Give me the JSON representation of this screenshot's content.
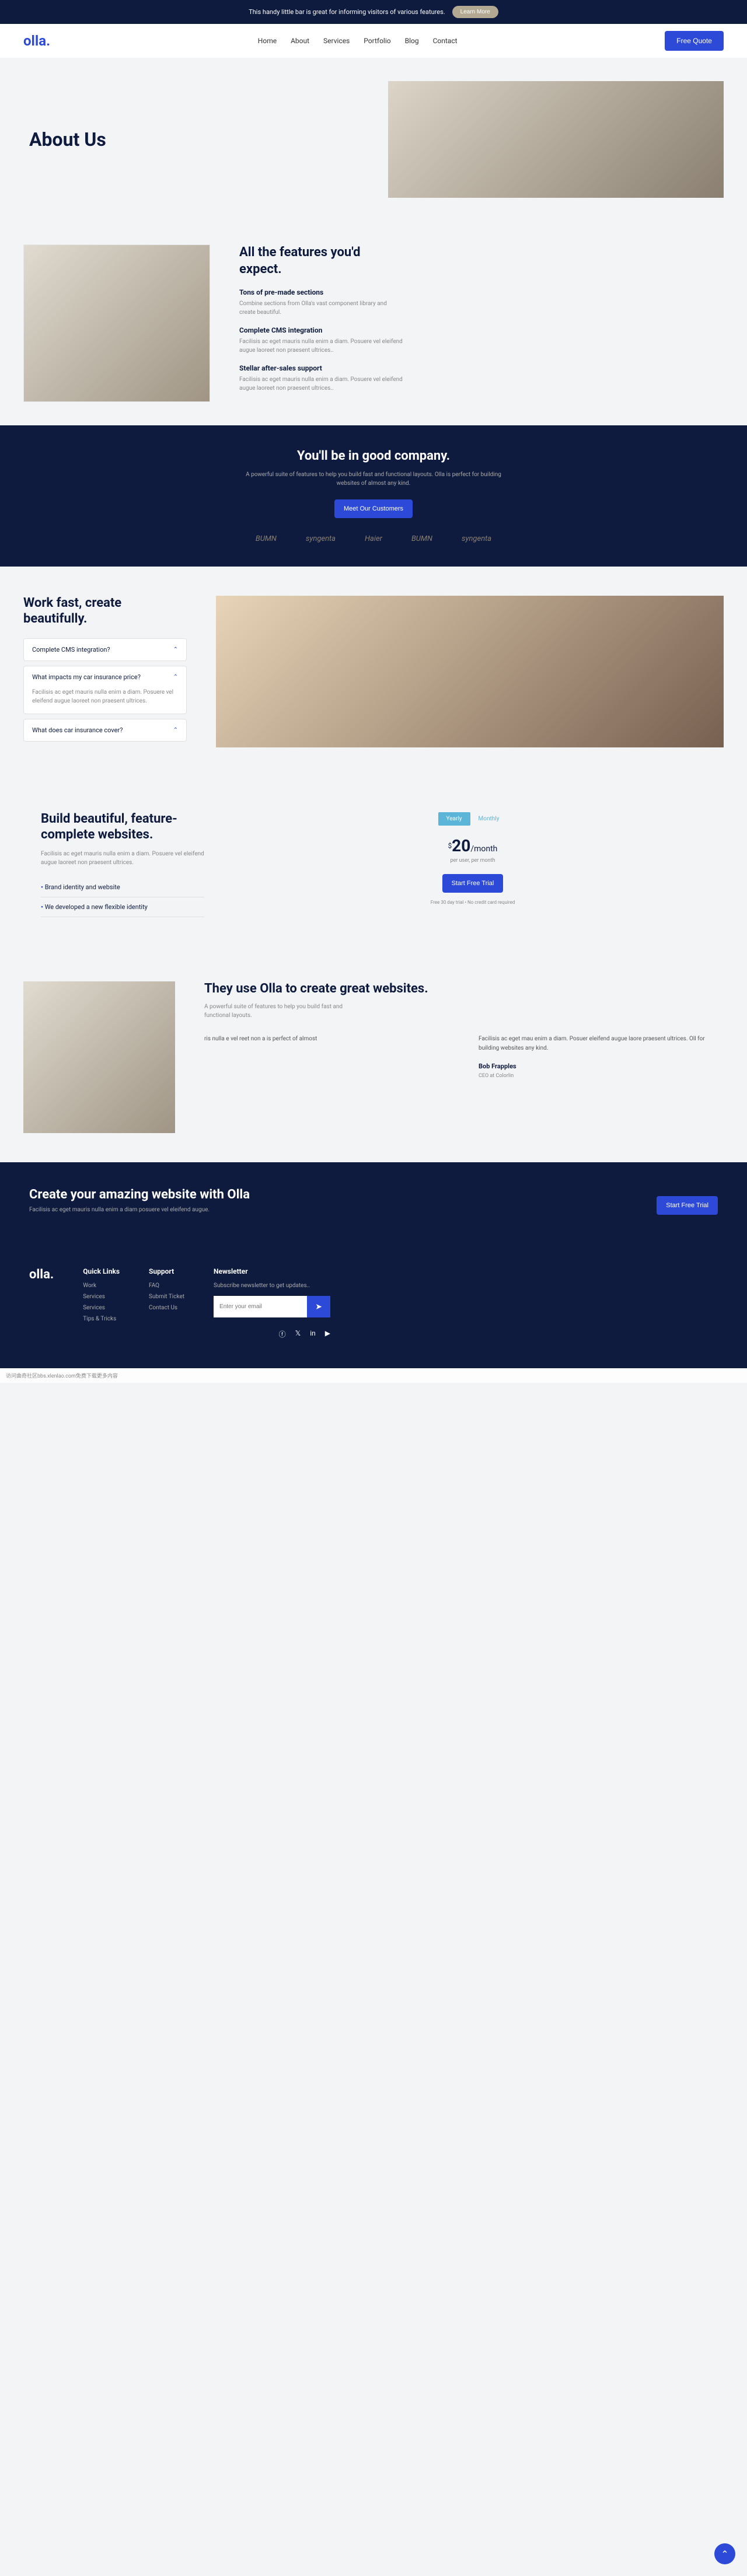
{
  "topbar": {
    "text": "This handy little bar is great for informing visitors of various features.",
    "button": "Learn More"
  },
  "brand": "olla.",
  "nav": [
    "Home",
    "About",
    "Services",
    "Portfolio",
    "Blog",
    "Contact"
  ],
  "quote": "Free Quote",
  "hero": {
    "title": "About Us"
  },
  "features": {
    "title": "All the features you'd expect.",
    "items": [
      {
        "h": "Tons of pre-made sections",
        "p": "Combine sections from Olla's vast component library and create beautiful."
      },
      {
        "h": "Complete CMS integration",
        "p": "Facilisis ac eget mauris nulla enim a diam. Posuere vel eleifend augue laoreet non praesent ultrices.."
      },
      {
        "h": "Stellar after-sales support",
        "p": "Facilisis ac eget mauris nulla enim a diam. Posuere vel eleifend augue laoreet non praesent ultrices.."
      }
    ]
  },
  "company": {
    "title": "You'll be in good company.",
    "text": "A powerful suite of features to help you build fast and functional layouts. Olla is perfect for building websites of almost any kind.",
    "button": "Meet Our Customers",
    "logos": [
      "BUMN",
      "syngenta",
      "Haier",
      "BUMN",
      "syngenta"
    ]
  },
  "accordion": {
    "title": "Work fast, create beautifully.",
    "items": [
      {
        "q": "Complete CMS integration?",
        "open": false
      },
      {
        "q": "What impacts my car insurance price?",
        "open": true,
        "a": "Facilisis ac eget mauris nulla enim a diam. Posuere vel eleifend augue laoreet non praesent ultrices."
      },
      {
        "q": "What does car insurance cover?",
        "open": false
      }
    ]
  },
  "pricing": {
    "title": "Build beautiful, feature-complete websites.",
    "text": "Facilisis ac eget mauris nulla enim a diam. Posuere vel eleifend augue laoreet non praesent ultrices.",
    "bullets": [
      "Brand identity and website",
      "We developed a new flexible identity"
    ],
    "tabs": {
      "active": "Yearly",
      "inactive": "Monthly"
    },
    "currency": "$",
    "amount": "20",
    "period": "/month",
    "sub": "per user, per month",
    "button": "Start Free Trial",
    "note": "Free 30 day trial • No credit card required"
  },
  "testimonial": {
    "title": "They use Olla to create great websites.",
    "text": "A powerful suite of features to help you build fast and functional layouts.",
    "col1": "ris nulla e vel reet non a is perfect of almost",
    "col2": "Facilisis ac eget mau enim a diam. Posuer eleifend augue laore praesent ultrices. Oll for building websites any kind.",
    "name": "Bob Frapples",
    "role": "CEO at Colorlin"
  },
  "cta": {
    "title": "Create your amazing website with Olla",
    "text": "Facilisis ac eget mauris nulla enim a diam posuere vel eleifend augue.",
    "button": "Start Free Trial"
  },
  "footer": {
    "quick": {
      "title": "Quick Links",
      "links": [
        "Work",
        "Services",
        "Services",
        "Tips & Tricks"
      ]
    },
    "support": {
      "title": "Support",
      "links": [
        "FAQ",
        "Submit Ticket",
        "Contact Us"
      ]
    },
    "newsletter": {
      "title": "Newsletter",
      "text": "Subscribe newsletter to get updates..",
      "placeholder": "Enter your email"
    }
  },
  "watermark": "访问曲奇社区bbs.xlenlao.com免费下载更多内容"
}
